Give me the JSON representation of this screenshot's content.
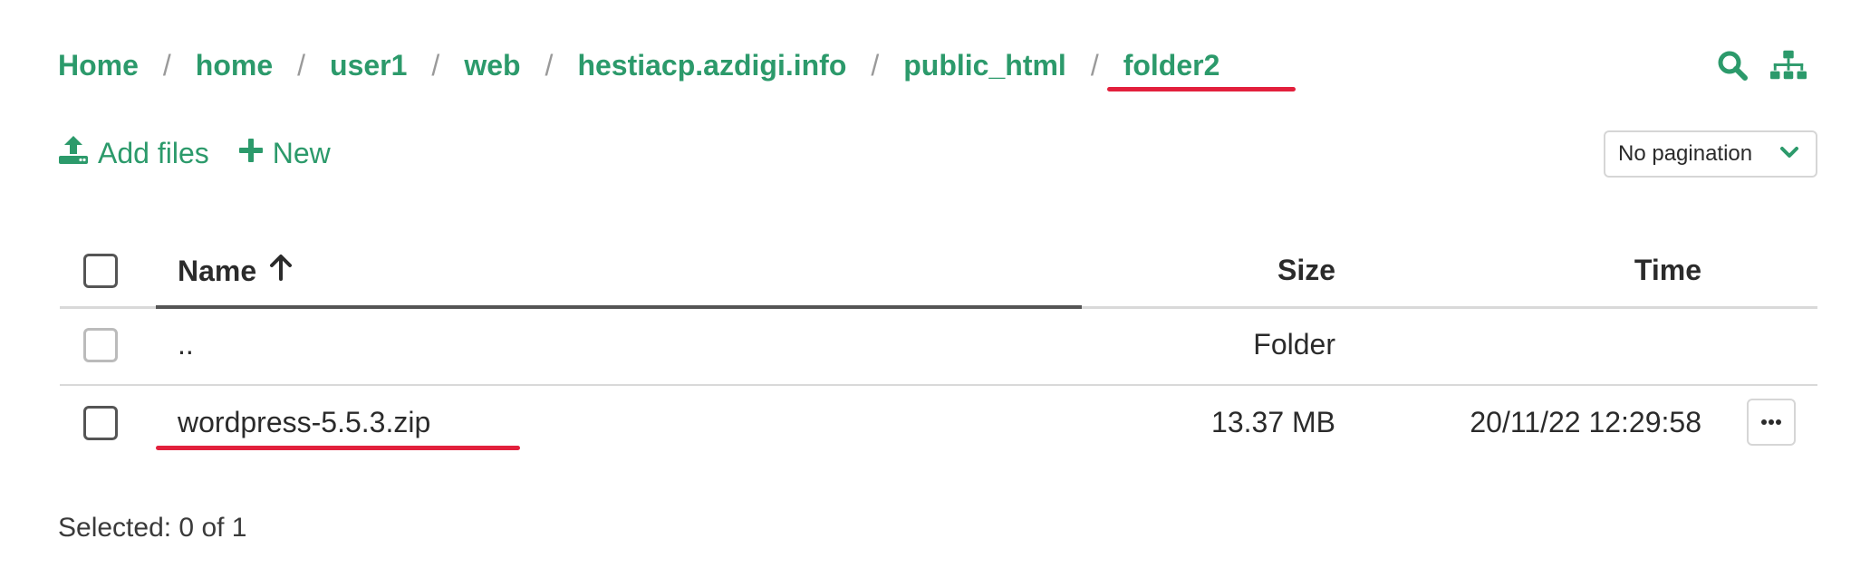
{
  "breadcrumb": {
    "items": [
      "Home",
      "home",
      "user1",
      "web",
      "hestiacp.azdigi.info",
      "public_html",
      "folder2"
    ],
    "separator": "/"
  },
  "toolbar": {
    "add_files_label": "Add files",
    "new_label": "New",
    "pagination_value": "No pagination"
  },
  "table": {
    "headers": {
      "name": "Name",
      "size": "Size",
      "time": "Time"
    },
    "sort_indicator": "arrow-up-icon",
    "rows": [
      {
        "name": "..",
        "size": "Folder",
        "time": ""
      },
      {
        "name": "wordpress-5.5.3.zip",
        "size": "13.37 MB",
        "time": "20/11/22 12:29:58"
      }
    ]
  },
  "footer": {
    "selected_text": "Selected: 0 of 1"
  },
  "colors": {
    "accent": "#2c9a6b",
    "highlight": "#e2203c"
  },
  "icons": [
    "search-icon",
    "sitemap-icon",
    "upload-icon",
    "plus-icon",
    "chevron-down-icon",
    "ellipsis-icon"
  ]
}
